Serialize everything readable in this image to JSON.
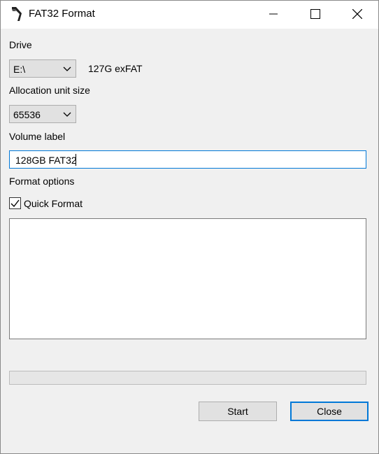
{
  "window": {
    "title": "FAT32 Format"
  },
  "drive": {
    "label": "Drive",
    "selected": "E:\\",
    "info": "127G exFAT"
  },
  "allocation": {
    "label": "Allocation unit size",
    "selected": "65536"
  },
  "volume": {
    "label": "Volume label",
    "value": "128GB FAT32"
  },
  "options": {
    "label": "Format options",
    "quick_format_label": "Quick Format",
    "quick_format_checked": true
  },
  "progress": {
    "fraction": 0
  },
  "buttons": {
    "start": "Start",
    "close": "Close"
  },
  "colors": {
    "accent": "#0078d7",
    "progress_fill": "#06b025"
  }
}
